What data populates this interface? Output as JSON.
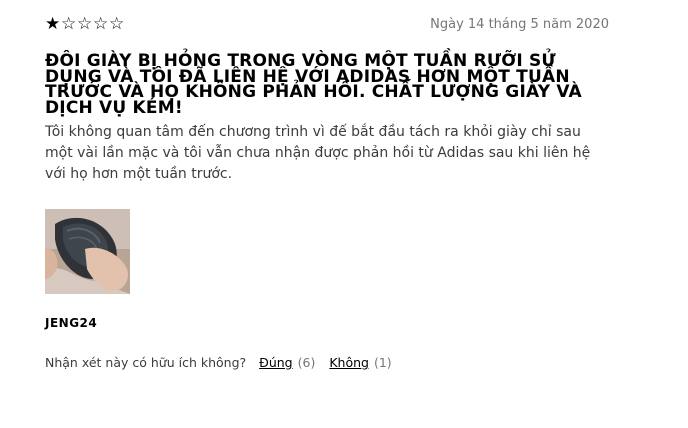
{
  "review": {
    "rating": 1,
    "rating_max": 5,
    "stars": [
      "★",
      "☆",
      "☆",
      "☆",
      "☆"
    ],
    "date": "Ngày 14 tháng 5 năm 2020",
    "title": "ĐÔI GIÀY BỊ HỎNG TRONG VÒNG MỘT TUẦN RƯỠI SỬ DỤNG VÀ TÔI ĐÃ LIÊN HỆ VỚI ADIDAS HƠN MỘT TUẦN TRƯỚC VÀ HỌ KHÔNG PHẢN HỒI. CHẤT LƯỢNG GIÀY VÀ DỊCH VỤ KÉM!",
    "body": "Tôi không quan tâm đến chương trình vì đế bắt đầu tách ra khỏi giày chỉ sau một vài lần mặc và tôi vẫn chưa nhận được phản hồi từ Adidas sau khi liên hệ với họ hơn một tuần trước.",
    "author": "JENG24",
    "helpful": {
      "question": "Nhận xét này có hữu ích không?",
      "yes_label": "Đúng",
      "yes_count": "(6)",
      "no_label": "Không",
      "no_count": "(1)"
    }
  },
  "colors": {
    "text": "#000000",
    "muted": "#767677",
    "body": "#3c3c3c"
  }
}
